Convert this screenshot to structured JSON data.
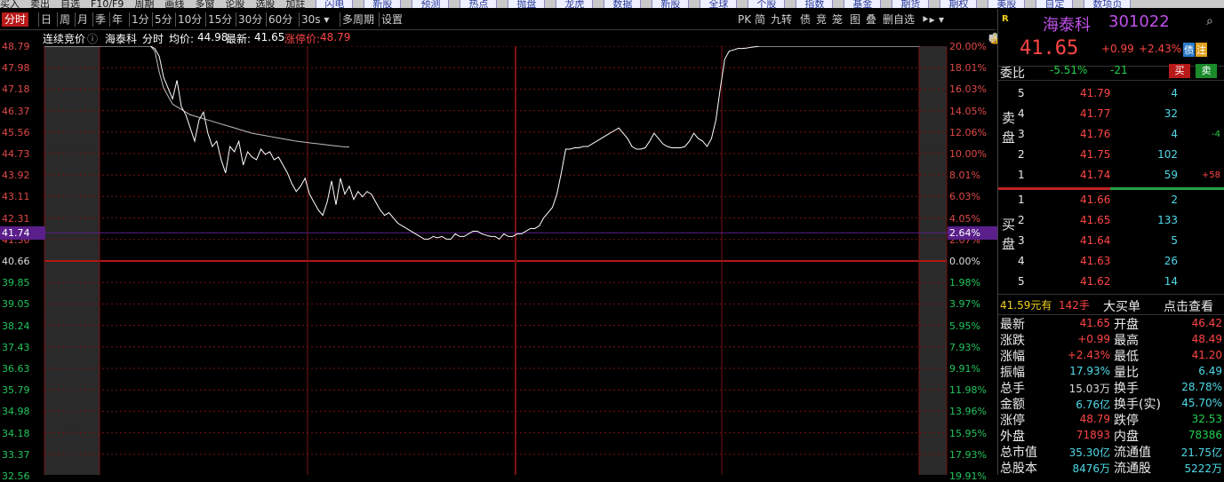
{
  "topbar": {
    "items": [
      "买入",
      "卖出",
      "自选",
      "F10/F9",
      "周期",
      "画线",
      "多窗",
      "论股",
      "选股",
      "加註"
    ],
    "buttons": [
      "闪电",
      "新股",
      "预测",
      "热点",
      "抛盘",
      "龙虎",
      "数据",
      "新股",
      "全球",
      "个股",
      "指数",
      "基金",
      "期货",
      "期权",
      "美股",
      "自定",
      "数项页"
    ]
  },
  "period_bar": {
    "items": [
      "分时",
      "日",
      "周",
      "月",
      "季",
      "年",
      "1分",
      "5分",
      "10分",
      "15分",
      "30分",
      "60分",
      "30s ▾",
      "多周期",
      "设置"
    ],
    "active": "分时",
    "right_items": [
      "PK",
      "简",
      "九转",
      "债",
      "竞",
      "笼",
      "图",
      "叠",
      "删自选",
      "⯈▸",
      "▾"
    ]
  },
  "info_bar": {
    "auction": "连续竞价",
    "stock_name": "海泰科",
    "mode": "分时",
    "avg_label": "均价:",
    "avg_value": "44.98",
    "latest_label": "最新:",
    "latest_value": "41.65",
    "limit_label": "涨停价:",
    "limit_value": "48.79"
  },
  "left_axis": [
    "48.79",
    "47.98",
    "47.18",
    "46.37",
    "45.56",
    "44.73",
    "43.92",
    "43.11",
    "42.31",
    "41.50",
    "40.66",
    "39.85",
    "39.05",
    "38.24",
    "37.43",
    "36.63",
    "35.79",
    "34.98",
    "34.18",
    "33.37",
    "32.56"
  ],
  "right_axis": [
    "20.00%",
    "18.01%",
    "16.03%",
    "14.05%",
    "12.06%",
    "10.00%",
    "8.01%",
    "6.03%",
    "4.05%",
    "2.07%",
    "0.00%",
    "1.98%",
    "3.97%",
    "5.95%",
    "7.93%",
    "9.91%",
    "11.98%",
    "13.96%",
    "15.95%",
    "17.93%",
    "19.91%"
  ],
  "current_marker": {
    "price": "41.74",
    "pct": "2.64%"
  },
  "price_line": [
    48.79,
    48.79,
    48.79,
    48.79,
    48.79,
    48.79,
    48.79,
    48.79,
    48.79,
    48.79,
    48.79,
    48.79,
    48.79,
    48.79,
    48.79,
    48.79,
    48.79,
    48.79,
    48.79,
    48.79,
    48.79,
    48.79,
    48.79,
    48.79,
    48.79,
    48.7,
    48.4,
    47.6,
    47.2,
    46.8,
    47.5,
    46.5,
    46.2,
    45.7,
    45.2,
    46.0,
    46.3,
    45.5,
    45.0,
    45.2,
    44.5,
    44.0,
    45.0,
    44.8,
    45.2,
    44.3,
    44.8,
    44.6,
    44.5,
    44.9,
    44.7,
    44.8,
    44.5,
    44.6,
    44.3,
    44.0,
    43.6,
    43.3,
    43.5,
    43.8,
    43.2,
    42.9,
    42.6,
    42.4,
    42.9,
    43.7,
    42.8,
    43.8,
    43.2,
    43.5,
    43.0,
    43.3,
    43.1,
    43.3,
    43.2,
    42.9,
    42.6,
    42.4,
    42.5,
    42.3,
    42.1,
    42.0,
    41.9,
    41.8,
    41.7,
    41.6,
    41.5,
    41.5,
    41.6,
    41.55,
    41.6,
    41.5,
    41.5,
    41.7,
    41.6,
    41.6,
    41.7,
    41.8,
    41.8,
    41.7,
    41.65,
    41.6,
    41.6,
    41.5,
    41.7,
    41.6,
    41.6,
    41.7,
    41.7,
    41.8,
    41.9,
    41.9,
    42.0,
    42.3,
    42.5,
    42.7,
    43.2,
    44.0,
    44.9,
    44.9,
    44.95,
    44.95,
    45.0,
    45.0,
    45.1,
    45.2,
    45.3,
    45.4,
    45.5,
    45.6,
    45.7,
    45.5,
    45.3,
    45.0,
    44.9,
    44.9,
    44.95,
    45.2,
    45.5,
    45.3,
    45.1,
    45.0,
    44.95,
    44.95,
    44.95,
    45.0,
    45.2,
    45.5,
    45.3,
    45.2,
    45.0,
    45.3,
    46.0,
    47.2,
    48.3,
    48.6,
    48.65,
    48.7,
    48.7,
    48.72,
    48.75,
    48.77,
    48.79,
    48.79,
    48.79,
    48.79,
    48.79,
    48.79,
    48.79,
    48.79,
    48.79,
    48.79,
    48.79,
    48.79,
    48.79,
    48.79,
    48.79,
    48.79,
    48.79,
    48.79,
    48.79,
    48.79,
    48.79,
    48.79,
    48.79,
    48.79,
    48.79,
    48.79,
    48.79,
    48.79,
    48.79,
    48.79,
    48.79,
    48.79,
    48.79,
    48.79,
    48.79,
    48.79,
    48.79
  ],
  "avg_line": [
    48.79,
    48.79,
    48.79,
    48.79,
    48.79,
    48.79,
    48.79,
    48.79,
    48.79,
    48.79,
    48.79,
    48.79,
    48.79,
    48.79,
    48.79,
    48.79,
    48.79,
    48.79,
    48.79,
    48.79,
    48.79,
    48.79,
    48.79,
    48.79,
    48.79,
    48.6,
    47.8,
    47.2,
    46.9,
    46.6,
    46.5,
    46.4,
    46.3,
    46.2,
    46.15,
    46.1,
    46.05,
    46.0,
    45.95,
    45.9,
    45.85,
    45.8,
    45.75,
    45.7,
    45.65,
    45.6,
    45.55,
    45.5,
    45.47,
    45.44,
    45.41,
    45.38,
    45.35,
    45.32,
    45.29,
    45.26,
    45.23,
    45.2,
    45.18,
    45.16,
    45.14,
    45.12,
    45.1,
    45.08,
    45.06,
    45.04,
    45.02,
    45.0,
    44.99,
    44.98
  ],
  "quote_panel": {
    "r_badge": "R",
    "name": "海泰科",
    "code": "301022",
    "price": "41.65",
    "change": "+0.99",
    "change_pct": "+2.43%",
    "tag_credit": "债",
    "tag_note": "注",
    "weibi_label": "委比",
    "weibi_value": "-5.51%",
    "weicha_value": "-21",
    "buy_btn": "买",
    "sell_btn": "卖",
    "sell_label": "卖盘",
    "buy_label": "买盘",
    "asks": [
      {
        "lvl": "5",
        "price": "41.79",
        "vol": "4",
        "chg": ""
      },
      {
        "lvl": "4",
        "price": "41.77",
        "vol": "32",
        "chg": ""
      },
      {
        "lvl": "3",
        "price": "41.76",
        "vol": "4",
        "chg": "-4"
      },
      {
        "lvl": "2",
        "price": "41.75",
        "vol": "102",
        "chg": ""
      },
      {
        "lvl": "1",
        "price": "41.74",
        "vol": "59",
        "chg": "+58"
      }
    ],
    "bids": [
      {
        "lvl": "1",
        "price": "41.66",
        "vol": "2"
      },
      {
        "lvl": "2",
        "price": "41.65",
        "vol": "133"
      },
      {
        "lvl": "3",
        "price": "41.64",
        "vol": "5"
      },
      {
        "lvl": "4",
        "price": "41.63",
        "vol": "26"
      },
      {
        "lvl": "5",
        "price": "41.62",
        "vol": "14"
      }
    ],
    "big_order": {
      "price": "41.59元有",
      "vol": "142手",
      "label": "大买单",
      "link": "点击查看"
    },
    "stats": [
      {
        "l1": "最新",
        "v1": "41.65",
        "l2": "开盘",
        "v2": "46.42"
      },
      {
        "l1": "涨跌",
        "v1": "+0.99",
        "l2": "最高",
        "v2": "48.49"
      },
      {
        "l1": "涨幅",
        "v1": "+2.43%",
        "l2": "最低",
        "v2": "41.20"
      },
      {
        "l1": "振幅",
        "v1": "17.93%",
        "l2": "量比",
        "v2": "6.49"
      },
      {
        "l1": "总手",
        "v1": "15.03万",
        "l2": "换手",
        "v2": "28.78%"
      },
      {
        "l1": "金额",
        "v1": "6.76亿",
        "l2": "换手(实)",
        "v2": "45.70%"
      },
      {
        "l1": "涨停",
        "v1": "48.79",
        "l2": "跌停",
        "v2": "32.53"
      },
      {
        "l1": "外盘",
        "v1": "71893",
        "l2": "内盘",
        "v2": "78386"
      },
      {
        "l1": "总市值",
        "v1": "35.30亿",
        "l2": "流通值",
        "v2": "21.75亿"
      },
      {
        "l1": "总股本",
        "v1": "8476万",
        "l2": "流通股",
        "v2": "5222万"
      }
    ]
  },
  "colors": {
    "up": "#ff4545",
    "down": "#22d04a",
    "grid": "#8b1a1a",
    "avg": "#e6e6e6",
    "price": "#ffffff",
    "accent": "#b81a1a"
  }
}
